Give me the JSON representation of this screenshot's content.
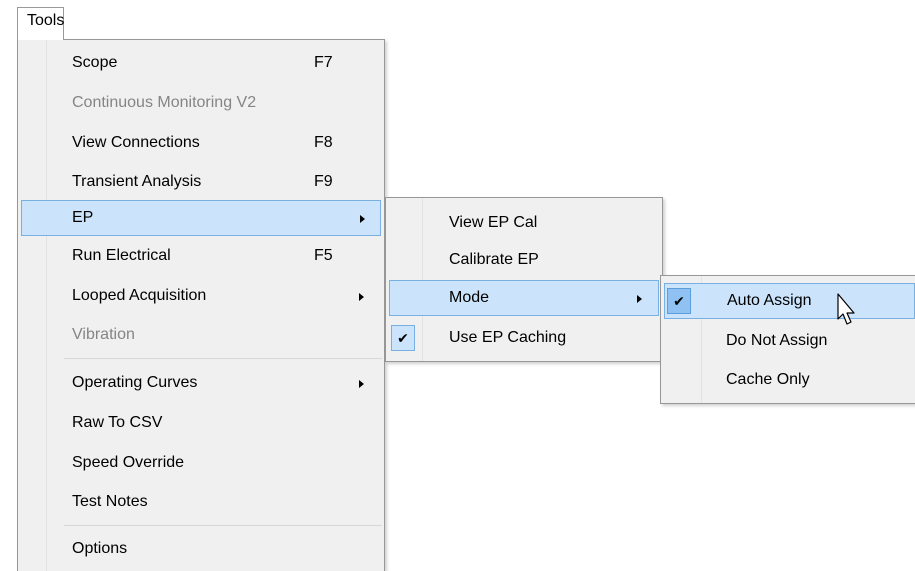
{
  "menubar": {
    "tools_label": "Tools"
  },
  "tools_menu": {
    "items": [
      {
        "label": "Scope",
        "shortcut": "F7"
      },
      {
        "label": "Continuous Monitoring V2"
      },
      {
        "label": "View Connections",
        "shortcut": "F8"
      },
      {
        "label": "Transient Analysis",
        "shortcut": "F9"
      },
      {
        "label": "EP"
      },
      {
        "label": "Run Electrical",
        "shortcut": "F5"
      },
      {
        "label": "Looped Acquisition"
      },
      {
        "label": "Vibration"
      },
      {
        "label": "Operating Curves"
      },
      {
        "label": "Raw To CSV"
      },
      {
        "label": "Speed Override"
      },
      {
        "label": "Test Notes"
      },
      {
        "label": "Options"
      }
    ]
  },
  "ep_menu": {
    "items": [
      {
        "label": "View EP Cal"
      },
      {
        "label": "Calibrate EP"
      },
      {
        "label": "Mode"
      },
      {
        "label": "Use EP Caching"
      }
    ]
  },
  "mode_menu": {
    "items": [
      {
        "label": "Auto Assign"
      },
      {
        "label": "Do Not Assign"
      },
      {
        "label": "Cache Only"
      }
    ]
  },
  "icons": {
    "check": "✔",
    "submenu_arrow": "chevron-right-icon",
    "cursor": "mouse-pointer-icon"
  },
  "colors": {
    "highlight": "#cce4fb",
    "highlight_border": "#79b0e3",
    "disabled_text": "#858585"
  }
}
